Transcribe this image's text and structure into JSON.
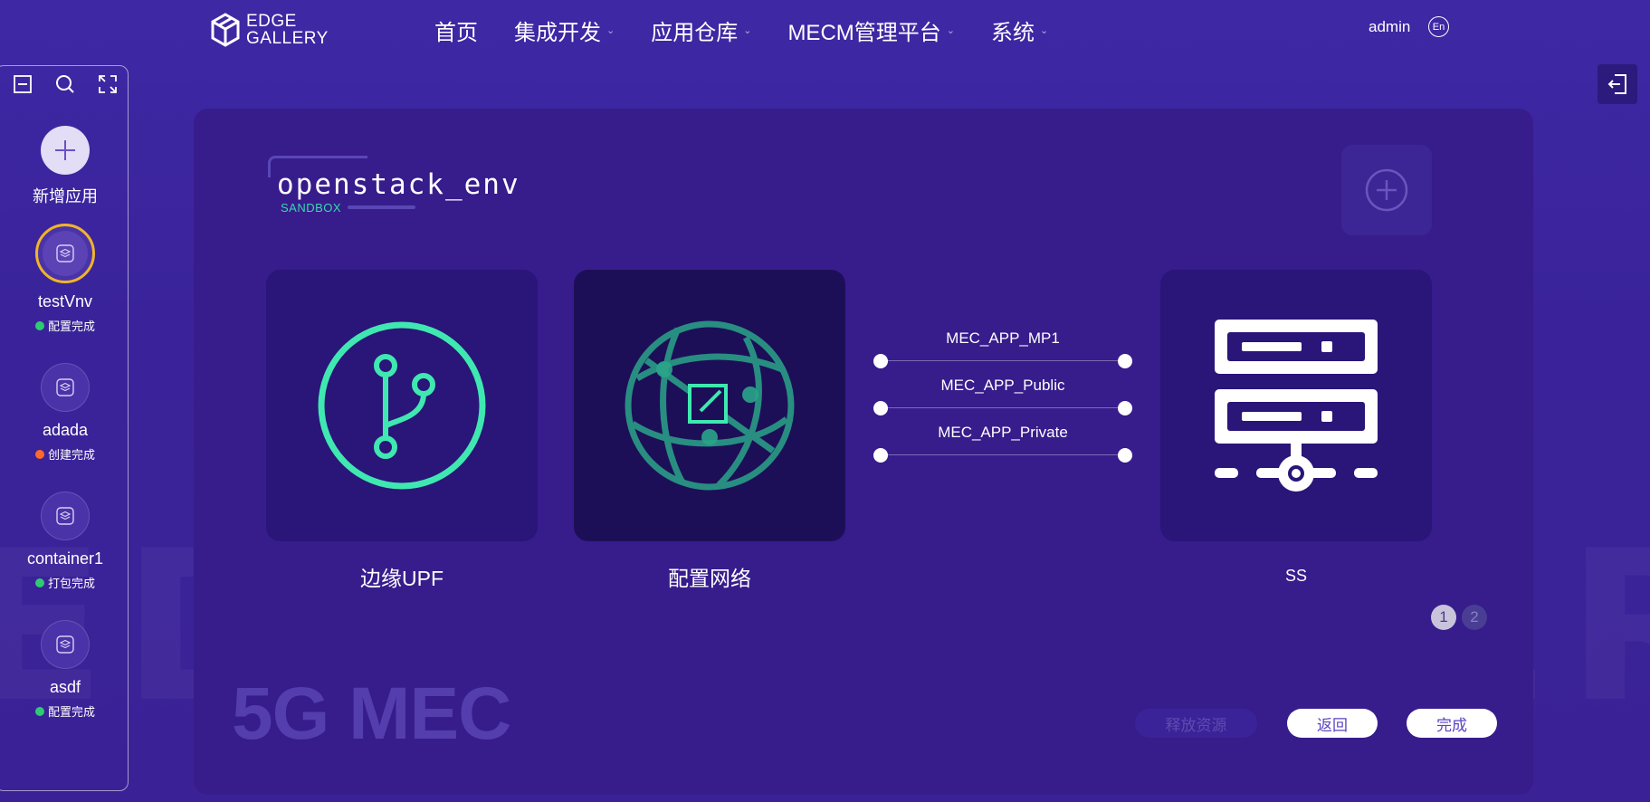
{
  "header": {
    "logo_line1": "EDGE",
    "logo_line2": "GALLERY",
    "nav": [
      {
        "label": "首页",
        "dropdown": false
      },
      {
        "label": "集成开发",
        "dropdown": true
      },
      {
        "label": "应用仓库",
        "dropdown": true
      },
      {
        "label": "MECM管理平台",
        "dropdown": true
      },
      {
        "label": "系统",
        "dropdown": true
      }
    ],
    "user": "admin",
    "lang": "En"
  },
  "sidebar": {
    "add_label": "新增应用",
    "apps": [
      {
        "name": "testVnv",
        "status": "配置完成",
        "status_color": "#2ecc71",
        "selected": true
      },
      {
        "name": "adada",
        "status": "创建完成",
        "status_color": "#ff6a2a",
        "selected": false
      },
      {
        "name": "container1",
        "status": "打包完成",
        "status_color": "#2ecc71",
        "selected": false
      },
      {
        "name": "asdf",
        "status": "配置完成",
        "status_color": "#2ecc71",
        "selected": false
      }
    ]
  },
  "main": {
    "env_title": "openstack_env",
    "env_subtitle": "SANDBOX",
    "cards": [
      {
        "label": "边缘UPF",
        "icon": "git-branch-icon"
      },
      {
        "label": "配置网络",
        "icon": "globe-edit-icon"
      },
      {
        "label": "SS",
        "icon": "server-icon"
      }
    ],
    "networks": [
      "MEC_APP_MP1",
      "MEC_APP_Public",
      "MEC_APP_Private"
    ],
    "pages": [
      "1",
      "2"
    ],
    "current_page": "1",
    "tagline": "5G MEC",
    "buttons": {
      "release": "释放资源",
      "back": "返回",
      "done": "完成"
    }
  },
  "watermark": "EDGE GALLERY",
  "colors": {
    "accent": "#3fe8b0",
    "background": "#3e28a4",
    "panel": "#371c8c"
  }
}
